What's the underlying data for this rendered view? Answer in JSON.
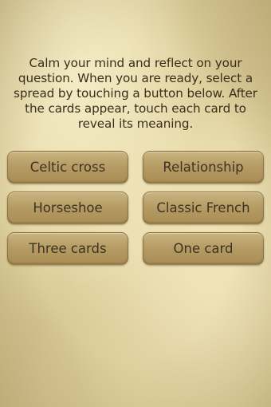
{
  "instructions": "Calm your mind and reflect on your question. When you are ready, select a spread by touching a button below. After the cards appear, touch each card to reveal its meaning.",
  "spreads": [
    {
      "label": "Celtic cross"
    },
    {
      "label": "Relationship"
    },
    {
      "label": "Horseshoe"
    },
    {
      "label": "Classic French"
    },
    {
      "label": "Three cards"
    },
    {
      "label": "One card"
    }
  ],
  "colors": {
    "background": "#e6d9a8",
    "button": "#b59b63",
    "text": "#3a2e1a"
  }
}
